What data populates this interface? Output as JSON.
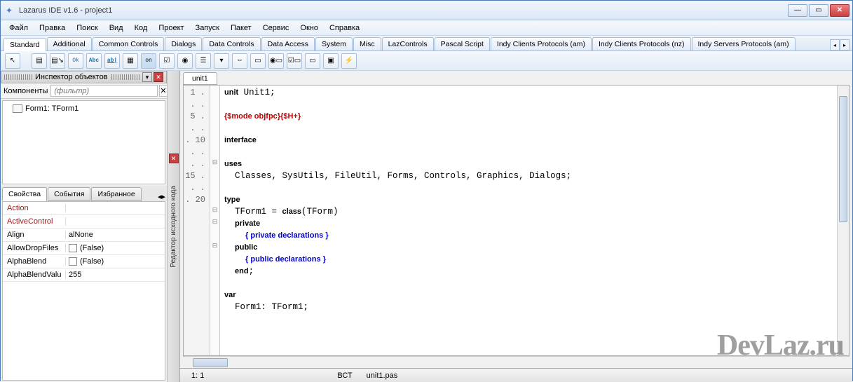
{
  "title": "Lazarus IDE v1.6 - project1",
  "menu": [
    "Файл",
    "Правка",
    "Поиск",
    "Вид",
    "Код",
    "Проект",
    "Запуск",
    "Пакет",
    "Сервис",
    "Окно",
    "Справка"
  ],
  "palette_tabs": [
    "Standard",
    "Additional",
    "Common Controls",
    "Dialogs",
    "Data Controls",
    "Data Access",
    "System",
    "Misc",
    "LazControls",
    "Pascal Script",
    "Indy Clients Protocols (am)",
    "Indy Clients Protocols (nz)",
    "Indy Servers Protocols (am)"
  ],
  "palette_active": "Standard",
  "inspector": {
    "title": "Инспектор объектов",
    "filter_label": "Компоненты",
    "filter_placeholder": "(фильтр)",
    "tree_item": "Form1: TForm1",
    "prop_tabs": [
      "Свойства",
      "События",
      "Избранное"
    ],
    "prop_active": "Свойства",
    "props": [
      {
        "name": "Action",
        "value": "",
        "red": true
      },
      {
        "name": "ActiveControl",
        "value": "",
        "red": true
      },
      {
        "name": "Align",
        "value": "alNone"
      },
      {
        "name": "AllowDropFiles",
        "value": "(False)",
        "check": true
      },
      {
        "name": "AlphaBlend",
        "value": "(False)",
        "check": true
      },
      {
        "name": "AlphaBlendValu",
        "value": "255"
      }
    ]
  },
  "side_panel": "Редактор исходного кода",
  "editor": {
    "tab": "unit1",
    "gutter": [
      "1",
      ".",
      ".",
      ".",
      "5",
      ".",
      ".",
      ".",
      ".",
      "10",
      ".",
      ".",
      ".",
      ".",
      "15",
      ".",
      ".",
      ".",
      ".",
      "20"
    ],
    "fold": [
      "",
      "",
      "",
      "",
      "",
      "",
      "⊟",
      "",
      "",
      "",
      "⊟",
      "⊟",
      "",
      "⊟",
      "",
      "",
      "",
      "",
      "",
      ""
    ]
  },
  "status": {
    "pos": "1: 1",
    "mode": "ВСТ",
    "file": "unit1.pas"
  },
  "watermark": "DevLaz.ru"
}
